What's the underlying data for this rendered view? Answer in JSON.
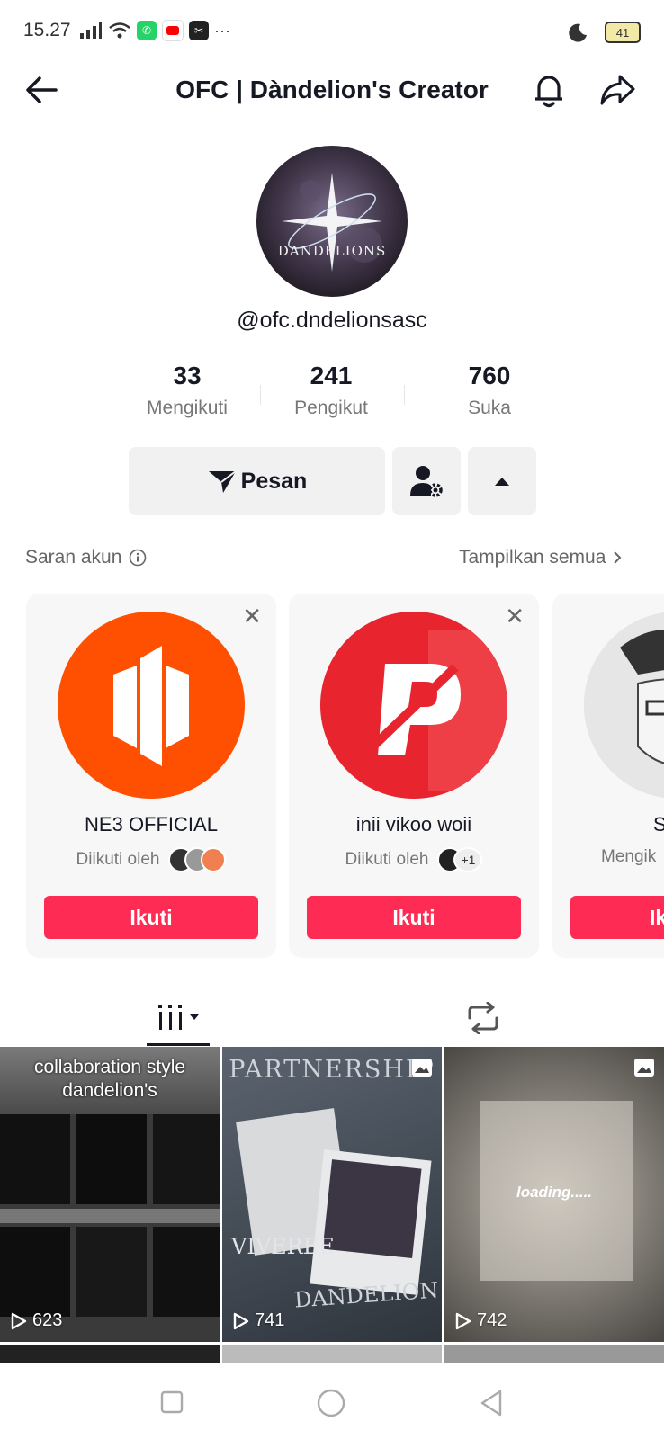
{
  "status": {
    "time": "15.27",
    "battery": "41",
    "more": "···"
  },
  "header": {
    "title": "OFC | Dàndelion's Creator"
  },
  "profile": {
    "handle": "@ofc.dndelionsasc",
    "avatar_text": "DANDELIONS",
    "stats": [
      {
        "num": "33",
        "label": "Mengikuti"
      },
      {
        "num": "241",
        "label": "Pengikut"
      },
      {
        "num": "760",
        "label": "Suka"
      }
    ]
  },
  "actions": {
    "message": "Pesan"
  },
  "suggestions": {
    "title": "Saran akun",
    "show_all": "Tampilkan semua",
    "cards": [
      {
        "name": "NE3 OFFICIAL",
        "followed_by": "Diikuti oleh",
        "extra": "",
        "button": "Ikuti"
      },
      {
        "name": "inii vikoo woii",
        "followed_by": "Diikuti oleh",
        "extra": "+1",
        "button": "Ikuti"
      },
      {
        "name": "S",
        "followed_by": "Mengik",
        "extra": "",
        "button": "Ik"
      }
    ]
  },
  "videos": [
    {
      "caption": "collaboration style dandelion's",
      "views": "623"
    },
    {
      "caption": "PARTNERSHIP",
      "caption2": "VIVEREE",
      "caption3": "DANDELION",
      "views": "741"
    },
    {
      "caption": "loading.....",
      "views": "742"
    }
  ],
  "colors": {
    "accent": "#fe2c55",
    "orange": "#fe5000",
    "red": "#e8252e"
  }
}
